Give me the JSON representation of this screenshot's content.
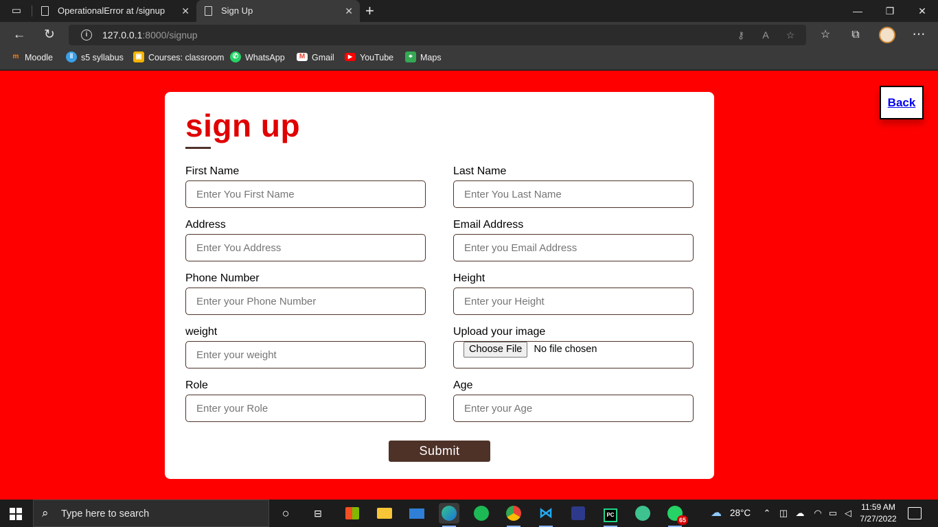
{
  "browser": {
    "tabs": [
      {
        "title": "OperationalError at /signup",
        "close": "✕"
      },
      {
        "title": "Sign Up",
        "close": "✕"
      }
    ],
    "new_tab": "+",
    "window_controls": {
      "minimize": "—",
      "restore": "❐",
      "close": "✕"
    },
    "address": {
      "host": "127.0.0.1",
      "rest": ":8000/signup"
    },
    "bookmarks": [
      {
        "label": "Moodle",
        "icon": "moodle-icon",
        "color": "#f98012"
      },
      {
        "label": "s5 syllabus",
        "icon": "s5-icon",
        "color": "#3aa0e8"
      },
      {
        "label": "Courses: classroom",
        "icon": "classroom-icon",
        "color": "#f4b400"
      },
      {
        "label": "WhatsApp",
        "icon": "whatsapp-icon",
        "color": "#25d366"
      },
      {
        "label": "Gmail",
        "icon": "gmail-icon",
        "color": "#ea4335"
      },
      {
        "label": "YouTube",
        "icon": "youtube-icon",
        "color": "#ff0000"
      },
      {
        "label": "Maps",
        "icon": "maps-icon",
        "color": "#34a853"
      }
    ]
  },
  "page": {
    "background": "#ff0000",
    "back_label": "Back",
    "heading": "sign up",
    "fields": {
      "first_name": {
        "label": "First Name",
        "placeholder": "Enter You First Name"
      },
      "last_name": {
        "label": "Last Name",
        "placeholder": "Enter You Last Name"
      },
      "address": {
        "label": "Address",
        "placeholder": "Enter You Address"
      },
      "email": {
        "label": "Email Address",
        "placeholder": "Enter you Email Address"
      },
      "phone": {
        "label": "Phone Number",
        "placeholder": "Enter your Phone Number"
      },
      "height": {
        "label": "Height",
        "placeholder": "Enter your Height"
      },
      "weight": {
        "label": "weight",
        "placeholder": "Enter your weight"
      },
      "image": {
        "label": "Upload your image",
        "button": "Choose File",
        "status": "No file chosen"
      },
      "role": {
        "label": "Role",
        "placeholder": "Enter your Role"
      },
      "age": {
        "label": "Age",
        "placeholder": "Enter your Age"
      }
    },
    "submit_label": "Submit",
    "accent_color": "#4e3228"
  },
  "taskbar": {
    "search_placeholder": "Type here to search",
    "weather": "28°C",
    "time": "11:59 AM",
    "date": "7/27/2022",
    "whatsapp_badge": "65"
  }
}
